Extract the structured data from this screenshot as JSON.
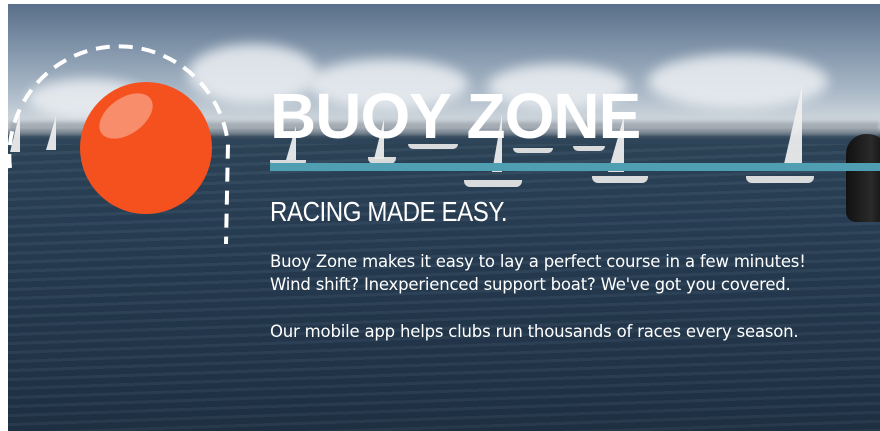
{
  "hero": {
    "title": "BUOY ZONE",
    "tagline": "RACING MADE EASY.",
    "paragraph1": {
      "line1": "Buoy Zone makes it easy to lay a perfect course in a few minutes!",
      "line2": "Wind shift? Inexperienced support boat? We've got you covered."
    },
    "paragraph2": "Our mobile app helps clubs run thousands of races every season."
  },
  "colors": {
    "buoy_orange": "#f4511e",
    "accent_rule": "#4f9eb2",
    "text": "#ffffff"
  },
  "icons": {
    "logo": "orange-buoy-icon"
  }
}
